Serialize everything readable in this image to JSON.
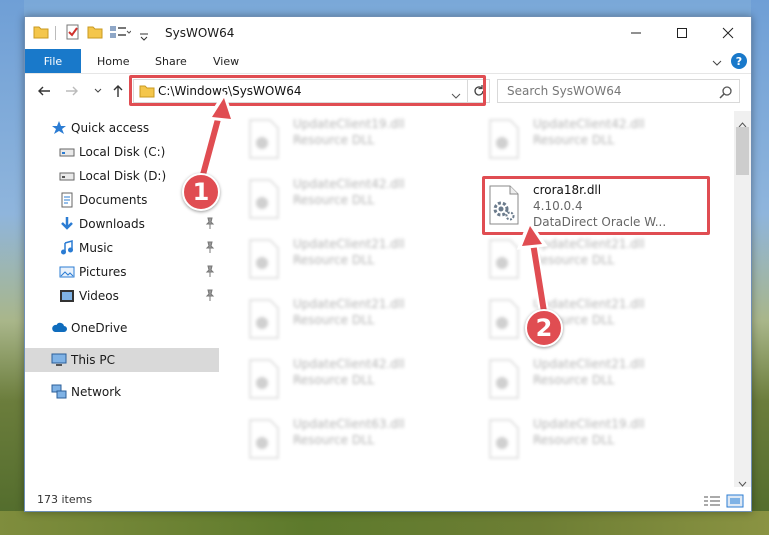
{
  "window": {
    "title": "SysWOW64"
  },
  "ribbon": {
    "tabs": [
      "File",
      "Home",
      "Share",
      "View"
    ],
    "help": "?"
  },
  "address": {
    "path": "C:\\Windows\\SysWOW64",
    "search_placeholder": "Search SysWOW64"
  },
  "sidebar": {
    "items": [
      {
        "label": "Quick access",
        "icon": "star-icon"
      },
      {
        "label": "Local Disk (C:)",
        "icon": "drive-icon"
      },
      {
        "label": "Local Disk (D:)",
        "icon": "drive-icon"
      },
      {
        "label": "Documents",
        "icon": "documents-icon"
      },
      {
        "label": "Downloads",
        "icon": "download-icon"
      },
      {
        "label": "Music",
        "icon": "music-icon"
      },
      {
        "label": "Pictures",
        "icon": "pictures-icon"
      },
      {
        "label": "Videos",
        "icon": "videos-icon"
      },
      {
        "label": "OneDrive",
        "icon": "cloud-icon"
      },
      {
        "label": "This PC",
        "icon": "computer-icon"
      },
      {
        "label": "Network",
        "icon": "network-icon"
      }
    ]
  },
  "files": {
    "left": [
      {
        "name": "UpdateClient19.dll",
        "type": "Resource DLL"
      },
      {
        "name": "UpdateClient42.dll",
        "type": "Resource DLL"
      },
      {
        "name": "UpdateClient21.dll",
        "type": "Resource DLL"
      },
      {
        "name": "UpdateClient21.dll",
        "type": "Resource DLL"
      },
      {
        "name": "UpdateClient42.dll",
        "type": "Resource DLL"
      },
      {
        "name": "UpdateClient63.dll",
        "type": "Resource DLL"
      }
    ],
    "right": [
      {
        "name": "UpdateClient42.dll",
        "type": "Resource DLL"
      },
      {
        "name": "UpdateClient21.dll",
        "type": "Resource DLL"
      },
      {
        "name": "UpdateClient21.dll",
        "type": "Resource DLL"
      },
      {
        "name": "UpdateClient21.dll",
        "type": "Resource DLL"
      },
      {
        "name": "UpdateClient19.dll",
        "type": "Resource DLL"
      }
    ],
    "highlighted": {
      "name": "crora18r.dll",
      "version": "4.10.0.4",
      "description": "DataDirect Oracle W..."
    }
  },
  "status": {
    "count": "173 items"
  },
  "callouts": [
    "1",
    "2"
  ],
  "colors": {
    "accent": "#1979ca",
    "highlight": "#e04d52",
    "folder": "#f4c64b"
  }
}
